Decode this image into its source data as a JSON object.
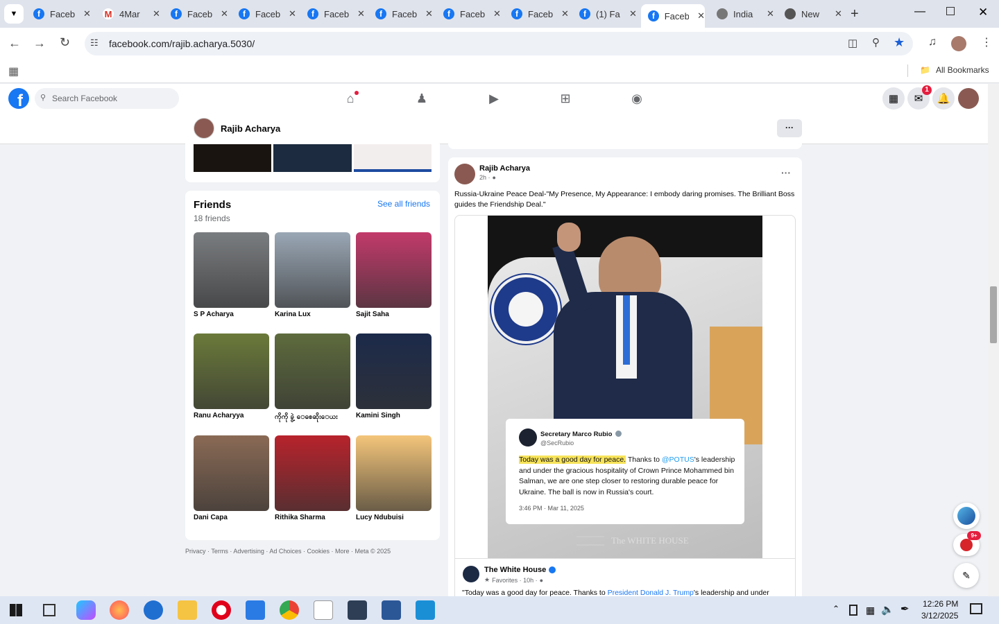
{
  "browser": {
    "tabs": [
      {
        "title": "Faceb",
        "icon": "facebook-icon"
      },
      {
        "title": "4Mar",
        "icon": "gmail-icon"
      },
      {
        "title": "Faceb",
        "icon": "facebook-icon"
      },
      {
        "title": "Faceb",
        "icon": "facebook-icon"
      },
      {
        "title": "Faceb",
        "icon": "facebook-icon"
      },
      {
        "title": "Faceb",
        "icon": "facebook-icon"
      },
      {
        "title": "Faceb",
        "icon": "facebook-icon"
      },
      {
        "title": "Faceb",
        "icon": "facebook-icon"
      },
      {
        "title": "(1) Fa",
        "icon": "facebook-icon"
      },
      {
        "title": "Faceb",
        "icon": "facebook-icon",
        "active": true
      },
      {
        "title": "India",
        "icon": "globe-icon"
      },
      {
        "title": "New",
        "icon": "github-icon"
      }
    ],
    "url": "facebook.com/rajib.acharya.5030/",
    "bookmarks_label": "All Bookmarks"
  },
  "fb": {
    "search_placeholder": "Search Facebook",
    "notif_badge": "1",
    "profile_name": "Rajib Acharya",
    "more_label": "···"
  },
  "friends": {
    "title": "Friends",
    "count": "18 friends",
    "see_all": "See all friends",
    "items": [
      {
        "name": "S P Acharya",
        "color": "#7a7d80"
      },
      {
        "name": "Karina Lux",
        "color": "#9aa7b5"
      },
      {
        "name": "Sajit Saha",
        "color": "#c23a6a"
      },
      {
        "name": "Ranu Acharyya",
        "color": "#6b7a3a"
      },
      {
        "name": "ကိုကို ခွဲ့ ေစေဆိုးေယး",
        "color": "#5e6b3d"
      },
      {
        "name": "Kamini Singh",
        "color": "#1c2a4a"
      },
      {
        "name": "Dani Capa",
        "color": "#8a6a55"
      },
      {
        "name": "Rithika Sharma",
        "color": "#b8232c"
      },
      {
        "name": "Lucy Ndubuisi",
        "color": "#f4c57a"
      }
    ]
  },
  "footer": {
    "links": [
      "Privacy",
      "Terms",
      "Advertising",
      "Ad Choices",
      "Cookies",
      "More",
      "Meta © 2025"
    ]
  },
  "post": {
    "author": "Rajib Acharya",
    "time": "2h ·",
    "text": "Russia-Ukraine Peace Deal-\"My Presence, My Appearance: I embody daring promises. The Brilliant Boss guides the Friendship Deal.\"",
    "tweet": {
      "name": "Secretary Marco Rubio",
      "handle": "@SecRubio",
      "highlight": "Today was a good day for peace.",
      "body_1": " Thanks to ",
      "mention": "@POTUS",
      "body_2": "'s leadership and under the gracious hospitality of Crown Prince Mohammed bin Salman, we are one step closer to restoring durable peace for Ukraine.  The ball is now in Russia's court.",
      "timestamp": "3:46 PM · Mar 11, 2025"
    },
    "image_footer": "The WHITE HOUSE",
    "shared": {
      "author": "The White House",
      "meta": "Favorites · 10h ·",
      "text_1": "\"Today was a good day for peace. Thanks to ",
      "link": "President Donald J. Trump",
      "text_2": "'s leadership and under"
    }
  },
  "floating": {
    "news_badge": "9+"
  },
  "taskbar": {
    "time": "12:26 PM",
    "date": "3/12/2025"
  }
}
